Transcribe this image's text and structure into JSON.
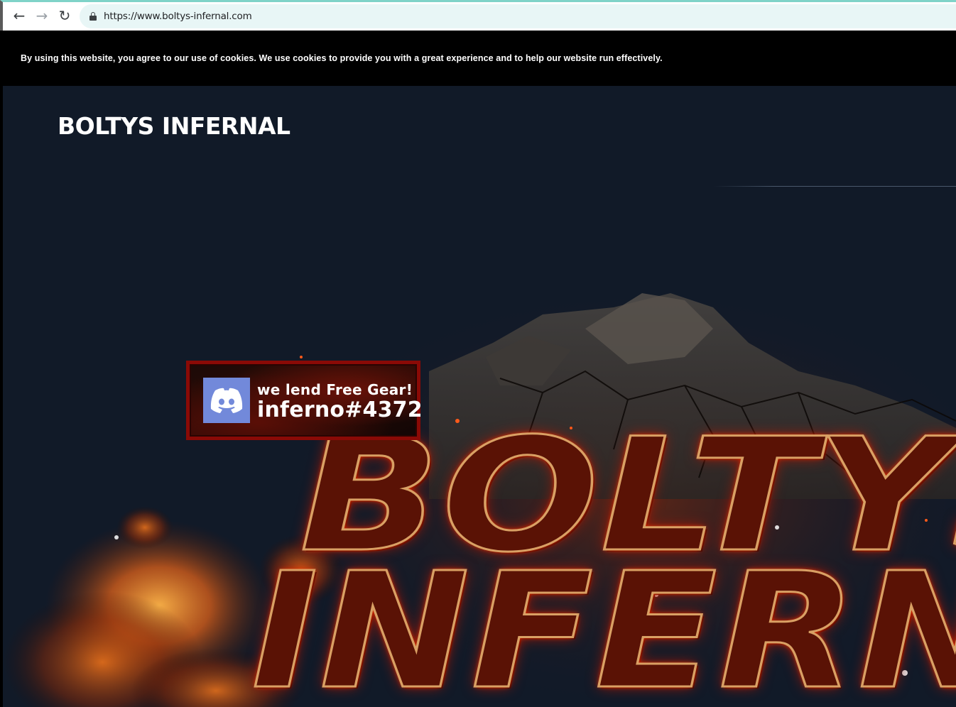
{
  "browser": {
    "url": "https://www.boltys-infernal.com",
    "icons": {
      "back": "arrow-left-icon",
      "forward": "arrow-right-icon",
      "reload": "reload-icon",
      "lock": "lock-icon"
    }
  },
  "cookie_banner": {
    "text": "By using this website, you agree to our use of cookies. We use cookies to provide you with a great experience and to help our website run effectively."
  },
  "header": {
    "site_title": "BOLTYS INFERNAL"
  },
  "discord_badge": {
    "line1": "we lend Free Gear!",
    "line2": "inferno#4372",
    "icon": "discord-logo-icon",
    "colors": {
      "logo_bg": "#7289da",
      "border": "#8a0a06"
    }
  },
  "hero": {
    "word1": "BOLTYS",
    "word2": "INFERN"
  },
  "colors": {
    "page_bg": "#111a28",
    "banner_bg": "#000000",
    "address_bar_bg": "#e8f6f6"
  }
}
